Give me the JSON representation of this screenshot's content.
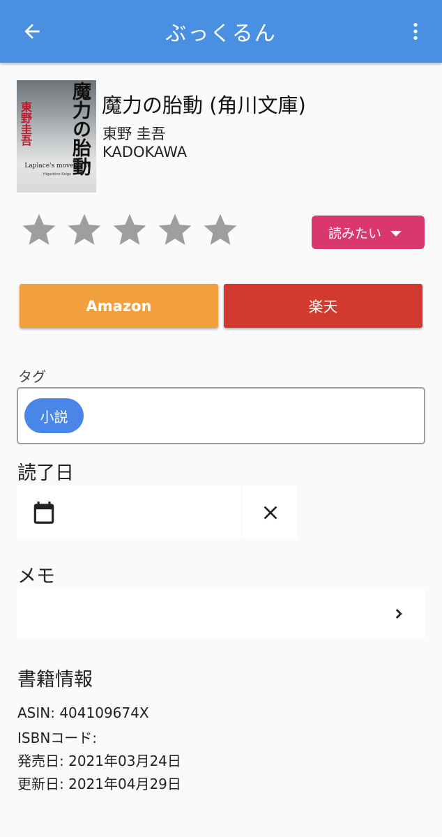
{
  "appbar": {
    "title": "ぶっくるん",
    "back_icon": "arrow-left-icon",
    "menu_icon": "more-vert-icon",
    "color": "#4a90e2"
  },
  "book": {
    "cover": {
      "title_text": "魔力の胎動",
      "author_text": "東野圭吾",
      "subtitle_text": "Laplace's movement",
      "small_text": "Higashino Keigo"
    },
    "title": "魔力の胎動 (角川文庫)",
    "author": "東野 圭吾",
    "publisher": "KADOKAWA"
  },
  "rating": {
    "max": 5,
    "value": 0,
    "star_color": "#9e9e9e"
  },
  "status": {
    "label": "読みたい",
    "color": "#d9376e"
  },
  "shops": {
    "amazon_label": "Amazon",
    "amazon_color": "#f1a03d",
    "rakuten_label": "楽天",
    "rakuten_color": "#d23a2f"
  },
  "tags": {
    "label": "タグ",
    "items": [
      "小説"
    ],
    "chip_color": "#4a86e8"
  },
  "read_date": {
    "heading": "読了日",
    "value": "",
    "calendar_icon": "calendar-icon",
    "clear_icon": "close-icon"
  },
  "memo": {
    "heading": "メモ",
    "value": "",
    "chevron_icon": "chevron-right-icon"
  },
  "book_info": {
    "heading": "書籍情報",
    "asin": "ASIN: 404109674X",
    "isbn": "ISBNコード:",
    "release_date": "発売日: 2021年03月24日",
    "updated_date": "更新日: 2021年04月29日"
  }
}
